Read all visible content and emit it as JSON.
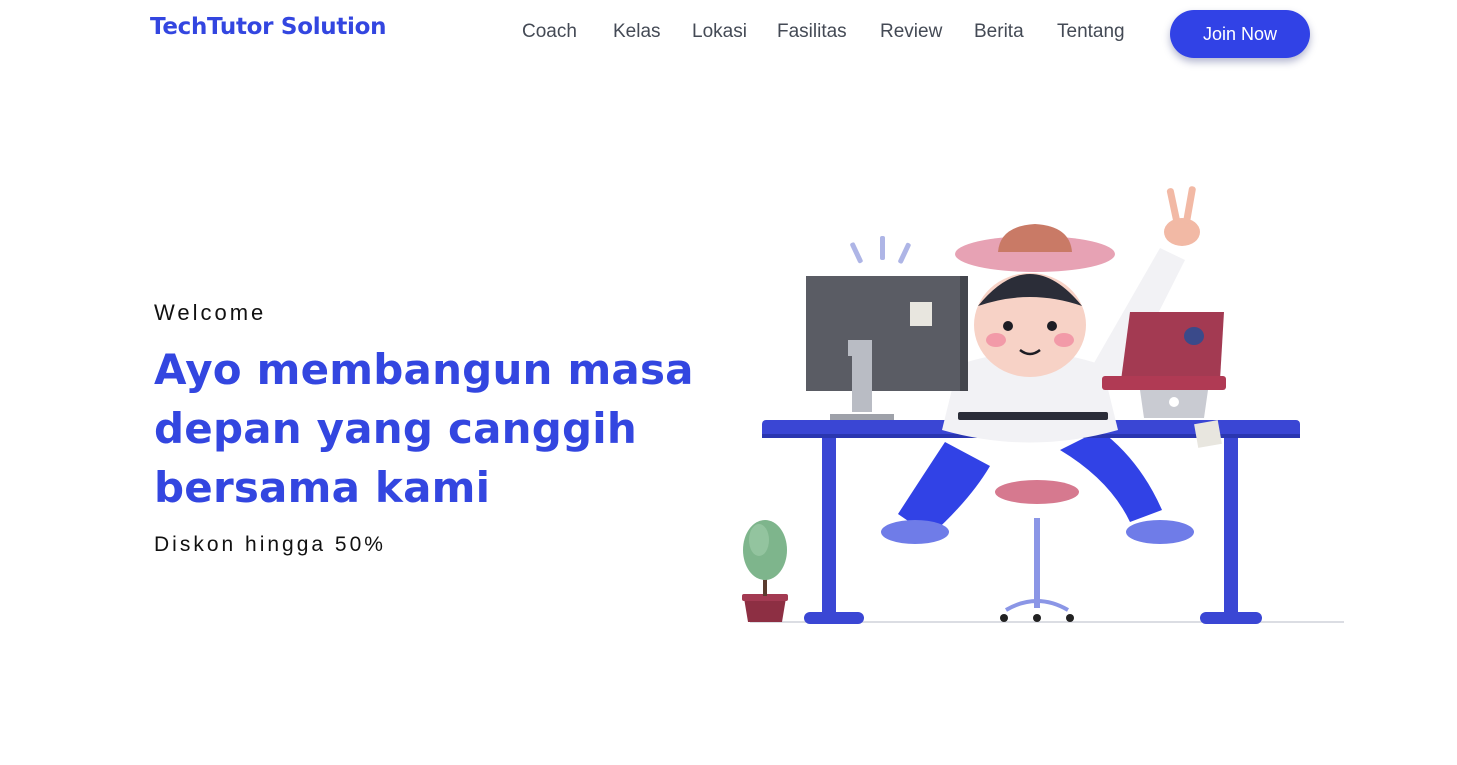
{
  "brand": {
    "name": "TechTutor Solution",
    "color": "#3346e0"
  },
  "nav": {
    "items": [
      "Coach",
      "Kelas",
      "Lokasi",
      "Fasilitas",
      "Review",
      "Berita",
      "Tentang"
    ],
    "cta_label": "Join Now"
  },
  "hero": {
    "eyebrow": "Welcome",
    "headline": "Ayo membangun masa depan yang canggih bersama kami",
    "subtext": "Diskon hingga 50%"
  },
  "illustration": {
    "icon": "person-at-desk-illustration",
    "accent": "#3142e6"
  }
}
